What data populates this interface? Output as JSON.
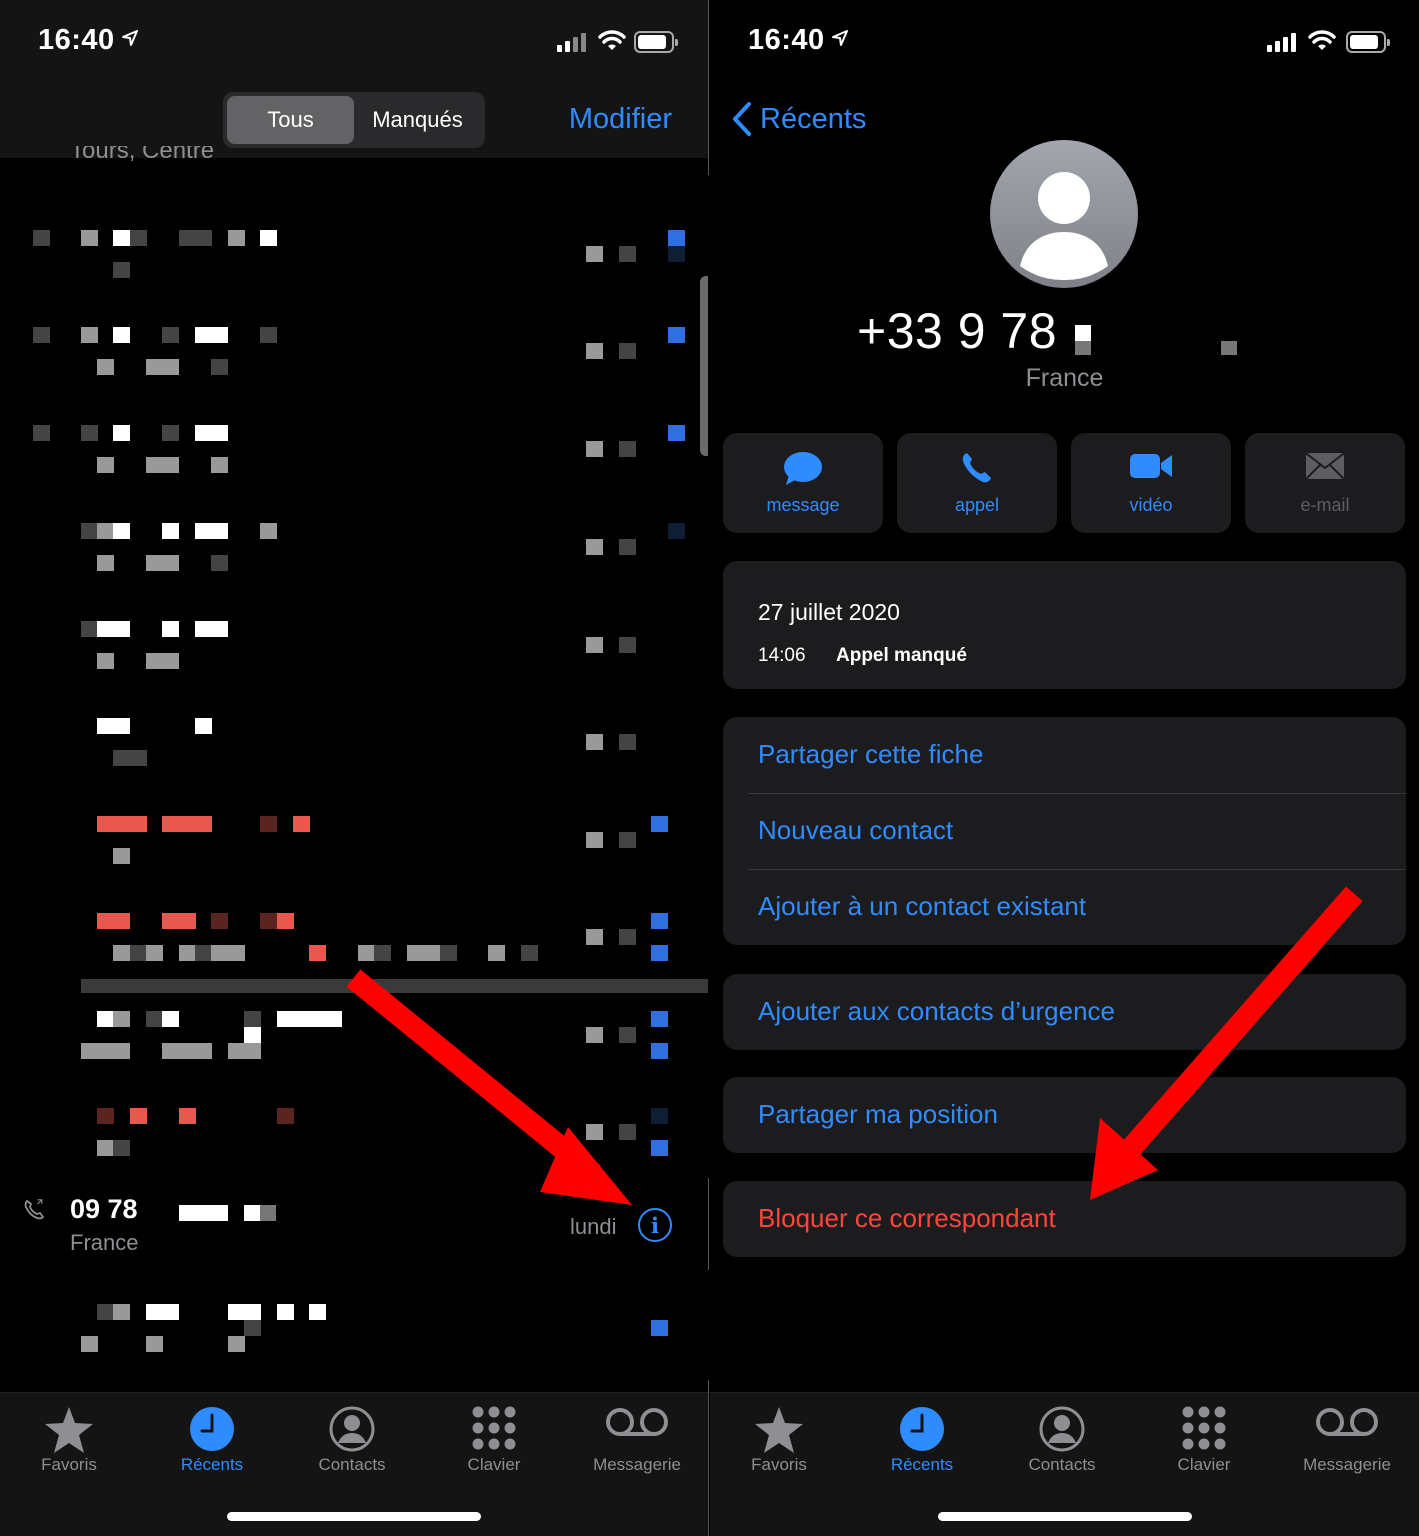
{
  "left": {
    "status": {
      "time": "16:40"
    },
    "segmented": {
      "all": "Tous",
      "missed": "Manqués"
    },
    "edit": "Modifier",
    "clipped_text": "Tours, Centre",
    "recent_entry": {
      "number": "09 78",
      "country": "France",
      "day": "lundi",
      "info": "i"
    }
  },
  "right": {
    "status": {
      "time": "16:40"
    },
    "back": "Récents",
    "contact": {
      "number": "+33 9 78",
      "country": "France"
    },
    "actions": [
      {
        "label": "message",
        "icon": "message-bubble-icon"
      },
      {
        "label": "appel",
        "icon": "phone-icon"
      },
      {
        "label": "vidéo",
        "icon": "video-camera-icon"
      },
      {
        "label": "e-mail",
        "icon": "envelope-icon"
      }
    ],
    "call": {
      "date": "27 juillet 2020",
      "time": "14:06",
      "status": "Appel manqué"
    },
    "options": {
      "share_card": "Partager cette fiche",
      "new_contact": "Nouveau contact",
      "add_existing": "Ajouter à un contact existant",
      "emergency": "Ajouter aux contacts d’urgence",
      "share_location": "Partager ma position",
      "block": "Bloquer ce correspondant"
    }
  },
  "tabs": [
    {
      "label": "Favoris",
      "icon": "star-icon"
    },
    {
      "label": "Récents",
      "icon": "clock-icon"
    },
    {
      "label": "Contacts",
      "icon": "person-circle-icon"
    },
    {
      "label": "Clavier",
      "icon": "keypad-icon"
    },
    {
      "label": "Messagerie",
      "icon": "voicemail-icon"
    }
  ],
  "colors": {
    "accent": "#2f8cff",
    "destructive": "#ff453a",
    "annotation": "#ff0000"
  }
}
